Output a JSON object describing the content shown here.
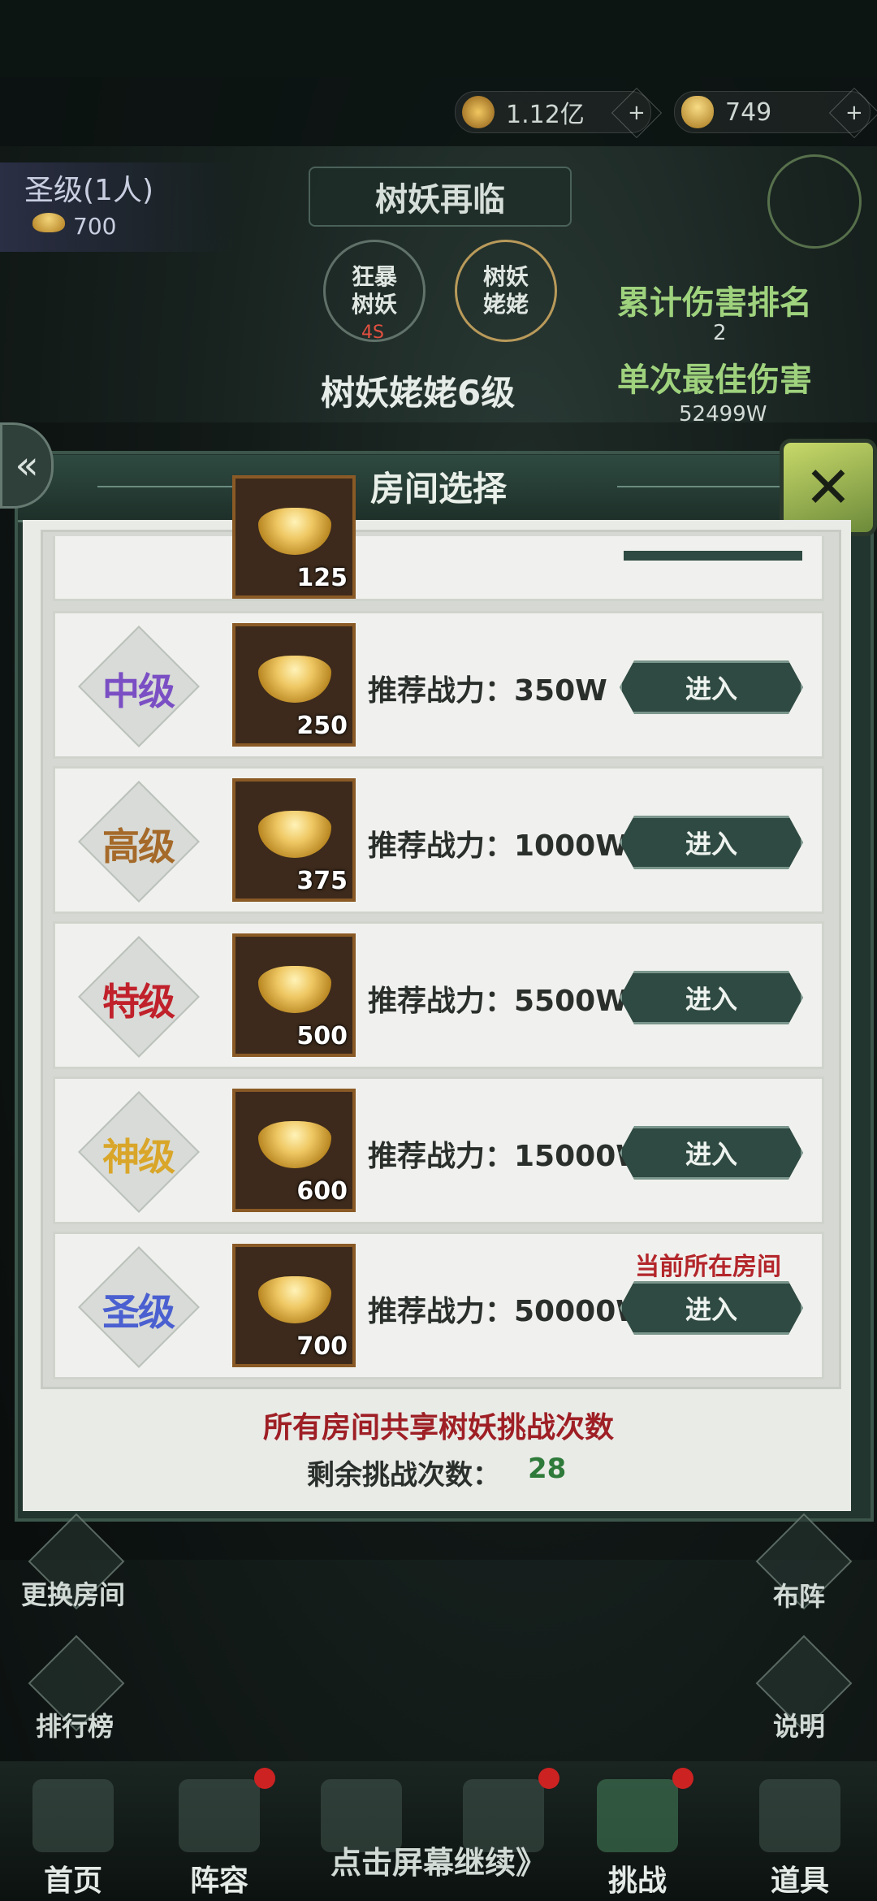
{
  "resources": {
    "coins": "1.12亿",
    "ingots": "749"
  },
  "room_badge": {
    "name": "圣级(1人)",
    "ingots": "700"
  },
  "boss": {
    "title": "树妖再临",
    "modes": [
      {
        "line1": "狂暴",
        "line2": "树妖"
      },
      {
        "line1": "树妖",
        "line2": "姥姥"
      }
    ],
    "timer": "4S",
    "level": "树妖姥姥6级"
  },
  "stats": {
    "rank_label": "累计伤害排名",
    "rank_value": "2",
    "best_label": "单次最佳伤害",
    "best_value": "52499W"
  },
  "modal": {
    "title": "房间选择",
    "partial_row_count": "125",
    "rows": [
      {
        "tier": "中级",
        "color": "#7b4fc4",
        "count": "250",
        "power": "推荐战力：350W",
        "button": "进入"
      },
      {
        "tier": "高级",
        "color": "#a56a2a",
        "count": "375",
        "power": "推荐战力：1000W",
        "button": "进入"
      },
      {
        "tier": "特级",
        "color": "#c0212b",
        "count": "500",
        "power": "推荐战力：5500W",
        "button": "进入"
      },
      {
        "tier": "神级",
        "color": "#d9a62a",
        "count": "600",
        "power": "推荐战力：15000W",
        "button": "进入"
      },
      {
        "tier": "圣级",
        "color": "#4a5fd0",
        "count": "700",
        "power": "推荐战力：50000W",
        "button": "进入"
      }
    ],
    "current_room": "当前所在房间",
    "shared_note": "所有房间共享树妖挑战次数",
    "remaining_label": "剩余挑战次数：",
    "remaining_value": "28"
  },
  "side_buttons": {
    "change_room": "更换房间",
    "leaderboard": "排行榜",
    "formation": "布阵",
    "help": "说明"
  },
  "nav": {
    "items": [
      {
        "label": "首页"
      },
      {
        "label": "阵容"
      },
      {
        "label": ""
      },
      {
        "label": ""
      },
      {
        "label": "挑战"
      },
      {
        "label": "道具"
      }
    ],
    "continue_hint": "点击屏幕继续》"
  }
}
